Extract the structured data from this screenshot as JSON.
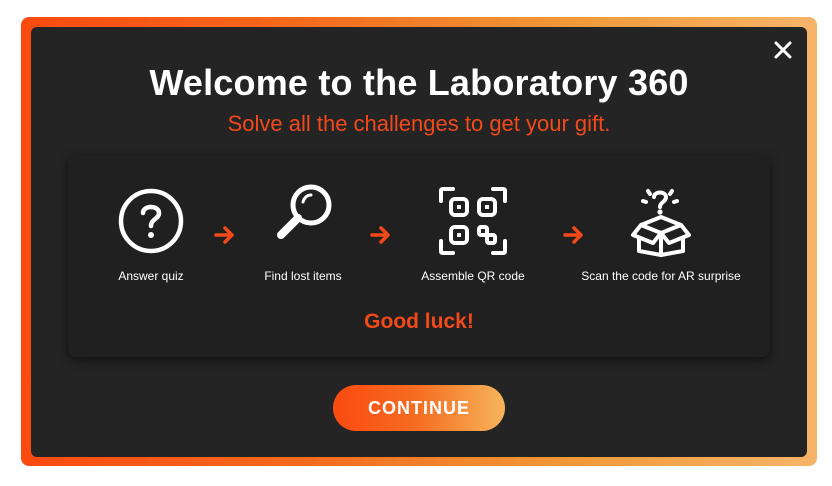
{
  "dialog": {
    "title": "Welcome to the Laboratory 360",
    "subtitle": "Solve all the challenges to get your gift.",
    "close_icon": "close-icon"
  },
  "steps": [
    {
      "label": "Answer quiz",
      "icon": "question-circle-icon"
    },
    {
      "label": "Find lost items",
      "icon": "magnifier-icon"
    },
    {
      "label": "Assemble QR code",
      "icon": "qr-code-icon"
    },
    {
      "label": "Scan the code for AR surprise",
      "icon": "surprise-box-icon"
    }
  ],
  "arrow_icon": "arrow-right-icon",
  "good_luck": "Good luck!",
  "continue_label": "CONTINUE",
  "colors": {
    "accent": "#f2491b",
    "background": "#242424",
    "card": "#202020",
    "gradient_start": "#fb4a10",
    "gradient_end": "#f6b55c"
  }
}
